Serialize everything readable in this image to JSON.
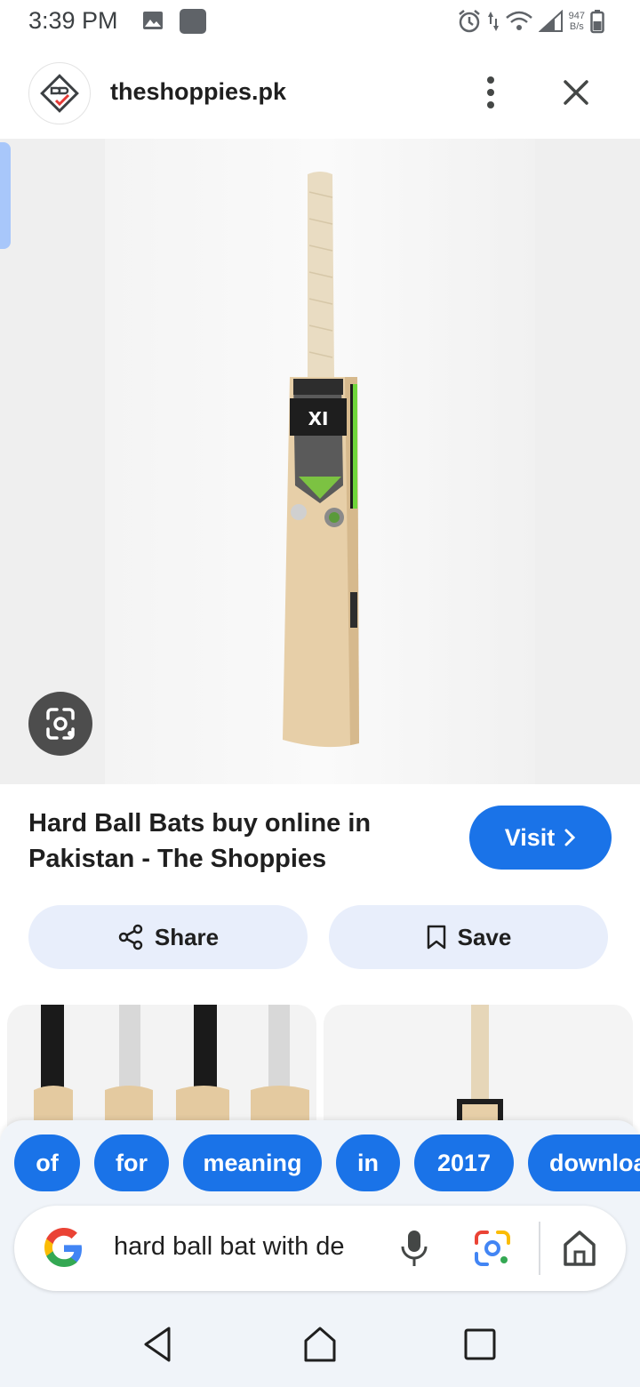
{
  "status_bar": {
    "time": "3:39 PM",
    "net_speed_value": "947",
    "net_speed_unit": "B/s"
  },
  "header": {
    "domain": "theshoppies.pk"
  },
  "result": {
    "title": "Hard Ball Bats buy online in Pakistan - The Shoppies",
    "visit_label": "Visit",
    "share_label": "Share",
    "save_label": "Save"
  },
  "chips": [
    "of",
    "for",
    "meaning",
    "in",
    "2017",
    "downloa"
  ],
  "search": {
    "query": "hard ball bat with de"
  },
  "colors": {
    "accent": "#1a73e8",
    "pill_bg": "#e8eefb",
    "panel_bg": "#f0f4f9"
  },
  "icons": {
    "menu": "more-vert-icon",
    "close": "close-icon",
    "lens": "google-lens-icon",
    "share": "share-icon",
    "save": "bookmark-icon",
    "mic": "mic-icon",
    "home": "home-icon"
  }
}
